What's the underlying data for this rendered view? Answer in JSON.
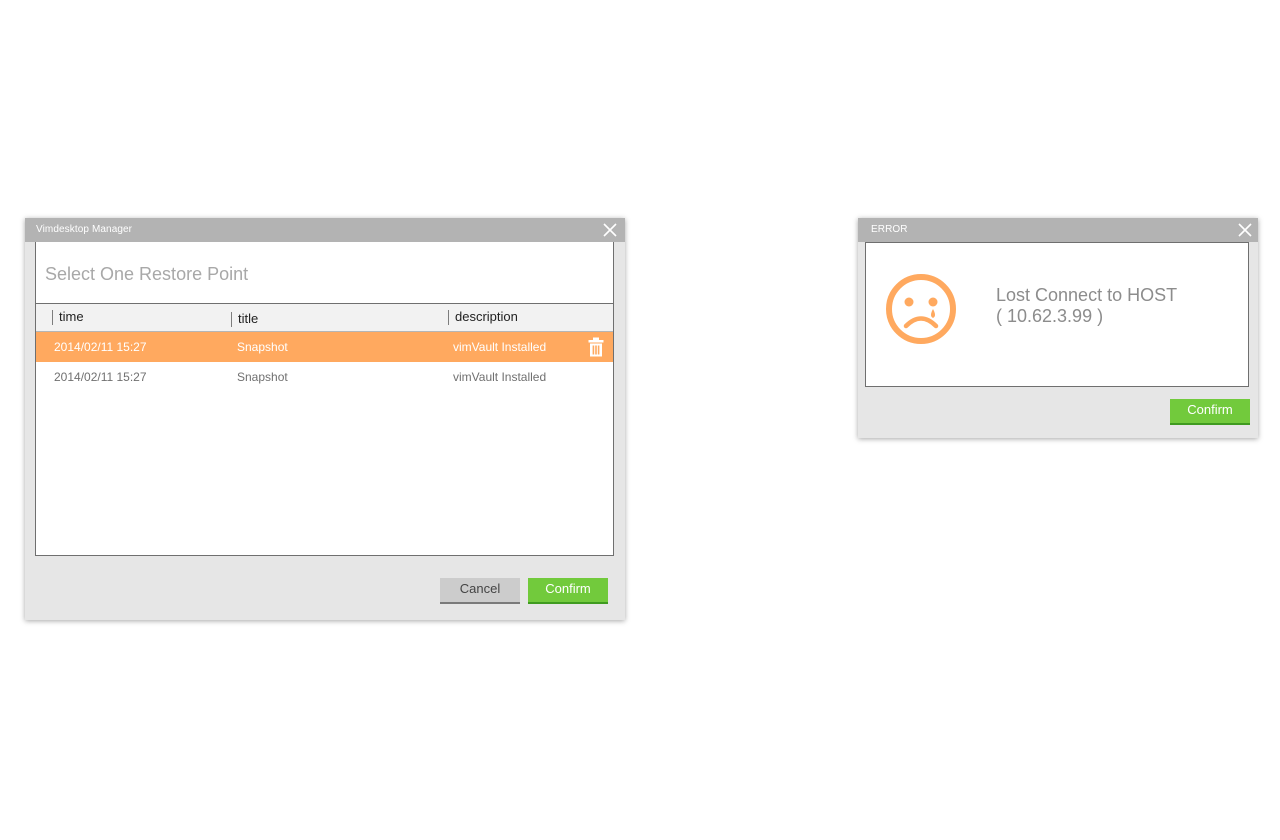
{
  "restore_dialog": {
    "window_title": "Vimdesktop Manager",
    "heading": "Select One Restore Point",
    "columns": [
      "time",
      "title",
      "description"
    ],
    "rows": [
      {
        "time": "2014/02/11 15:27",
        "title": "Snapshot",
        "description": "vimVault Installed",
        "selected": true
      },
      {
        "time": "2014/02/11 15:27",
        "title": "Snapshot",
        "description": "vimVault Installed",
        "selected": false
      }
    ],
    "cancel_label": "Cancel",
    "confirm_label": "Confirm"
  },
  "error_dialog": {
    "window_title": "ERROR",
    "message_line1": "Lost Connect to HOST",
    "message_line2": "( 10.62.3.99 )",
    "confirm_label": "Confirm",
    "icon": "sad-face-icon"
  },
  "colors": {
    "accent_orange": "#ffa95f",
    "confirm_green": "#72ca3c",
    "titlebar_gray": "#b3b3b3"
  }
}
